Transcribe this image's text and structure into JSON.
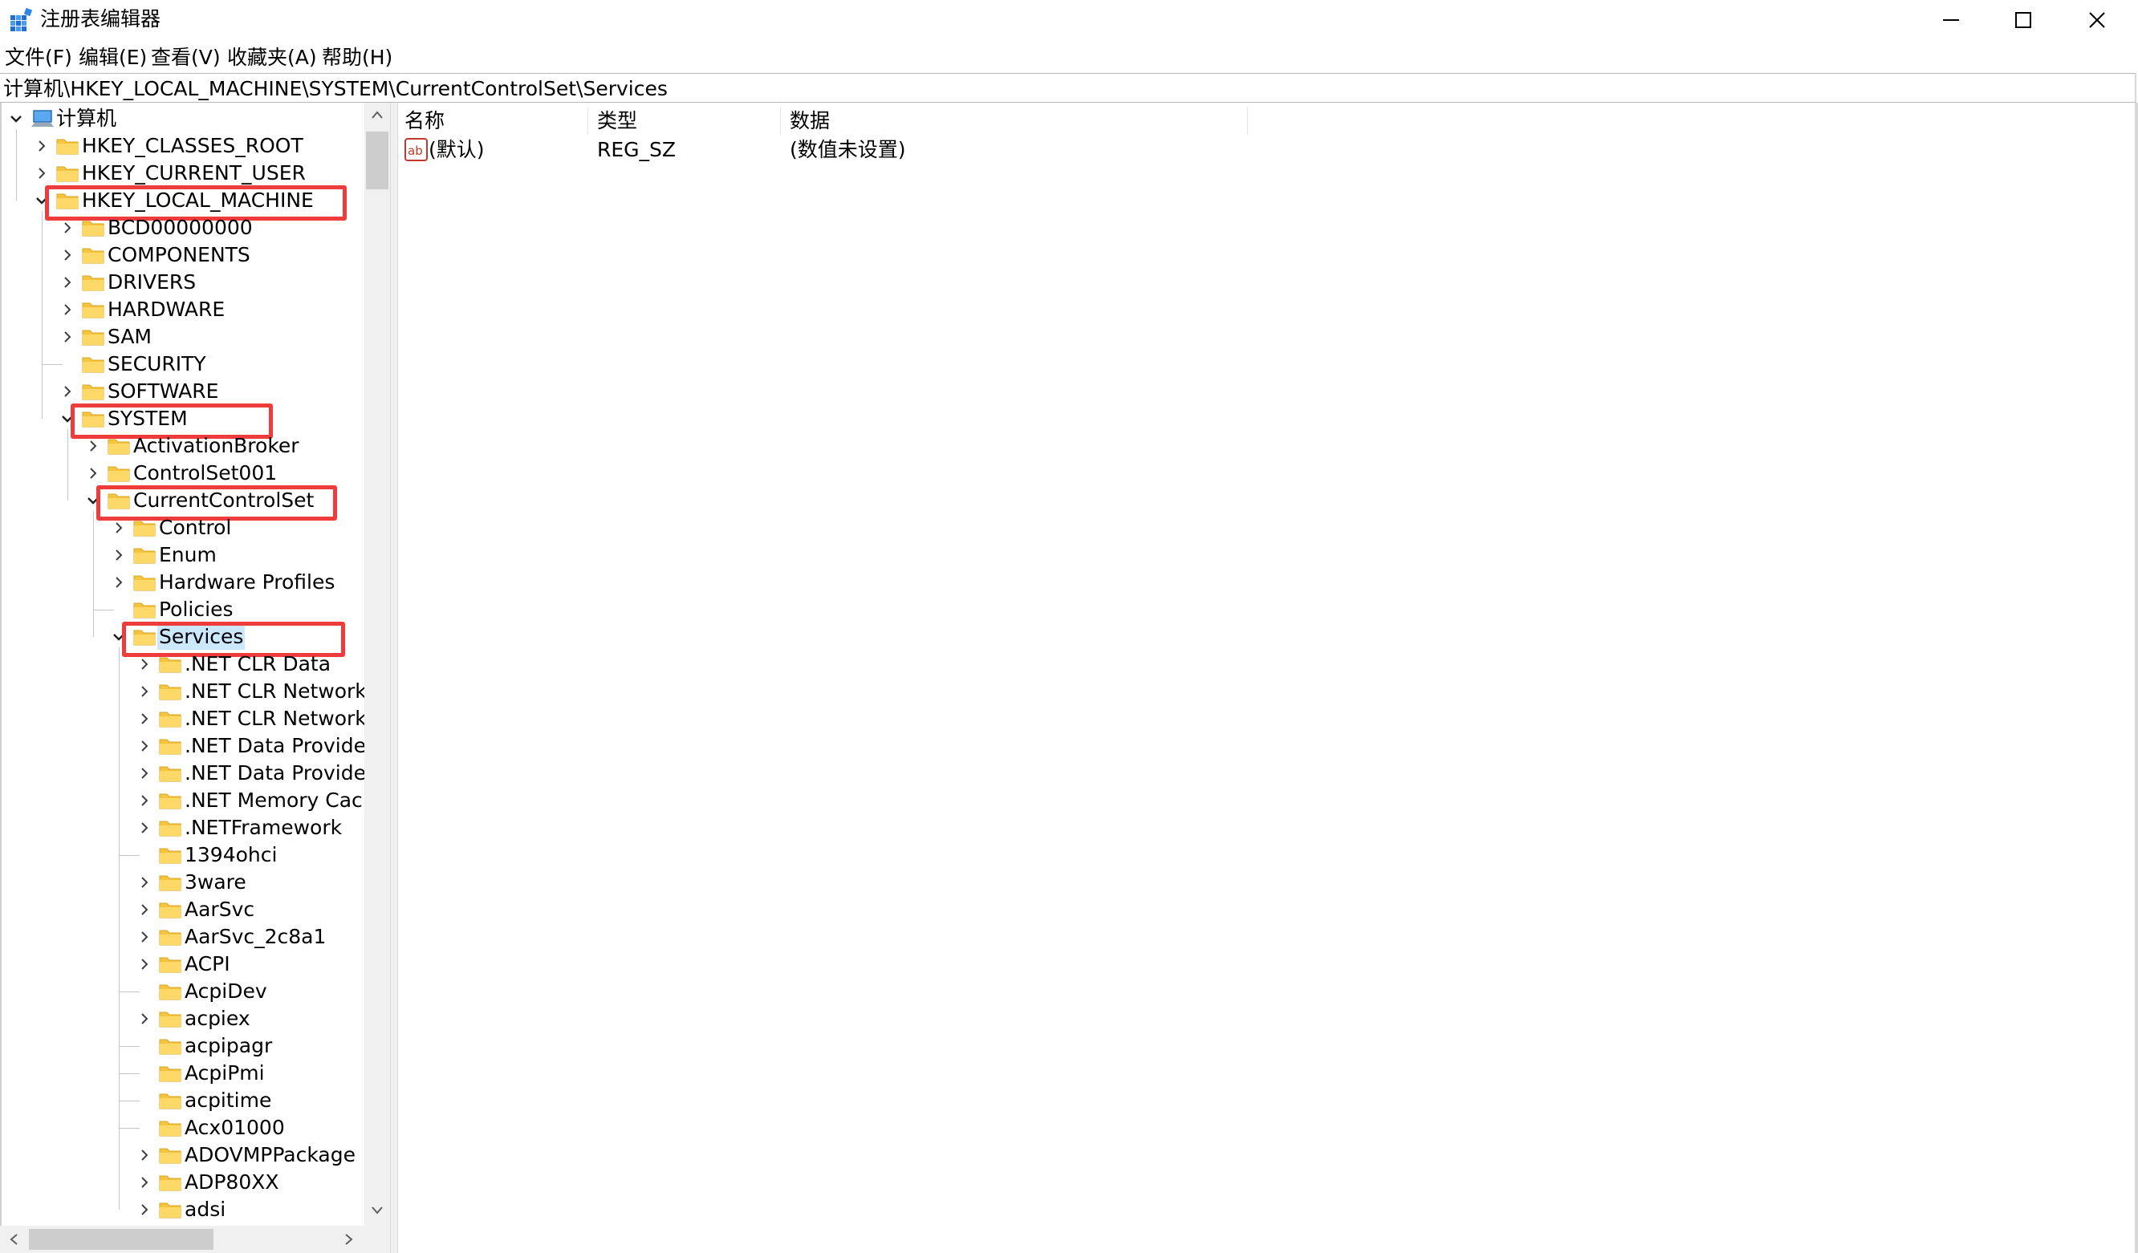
{
  "window": {
    "title": "注册表编辑器",
    "icon": "registry-editor-icon",
    "controls": [
      "minimize-icon",
      "maximize-icon",
      "close-icon"
    ]
  },
  "menu": {
    "items": [
      {
        "label": "文件(F)"
      },
      {
        "label": "编辑(E)"
      },
      {
        "label": "查看(V)"
      },
      {
        "label": "收藏夹(A)"
      },
      {
        "label": "帮助(H)"
      }
    ]
  },
  "address": {
    "path": "计算机\\HKEY_LOCAL_MACHINE\\SYSTEM\\CurrentControlSet\\Services"
  },
  "tree": {
    "root": {
      "label": "计算机",
      "icon": "computer-icon",
      "expanded": true
    },
    "nodes": [
      {
        "label": "HKEY_CLASSES_ROOT",
        "depth": 1,
        "state": "collapsed"
      },
      {
        "label": "HKEY_CURRENT_USER",
        "depth": 1,
        "state": "collapsed"
      },
      {
        "label": "HKEY_LOCAL_MACHINE",
        "depth": 1,
        "state": "expanded",
        "highlighted": true
      },
      {
        "label": "BCD00000000",
        "depth": 2,
        "state": "collapsed"
      },
      {
        "label": "COMPONENTS",
        "depth": 2,
        "state": "collapsed"
      },
      {
        "label": "DRIVERS",
        "depth": 2,
        "state": "collapsed"
      },
      {
        "label": "HARDWARE",
        "depth": 2,
        "state": "collapsed"
      },
      {
        "label": "SAM",
        "depth": 2,
        "state": "collapsed"
      },
      {
        "label": "SECURITY",
        "depth": 2,
        "state": "leaf"
      },
      {
        "label": "SOFTWARE",
        "depth": 2,
        "state": "collapsed"
      },
      {
        "label": "SYSTEM",
        "depth": 2,
        "state": "expanded",
        "highlighted": true
      },
      {
        "label": "ActivationBroker",
        "depth": 3,
        "state": "collapsed"
      },
      {
        "label": "ControlSet001",
        "depth": 3,
        "state": "collapsed"
      },
      {
        "label": "CurrentControlSet",
        "depth": 3,
        "state": "expanded",
        "highlighted": true
      },
      {
        "label": "Control",
        "depth": 4,
        "state": "collapsed"
      },
      {
        "label": "Enum",
        "depth": 4,
        "state": "collapsed"
      },
      {
        "label": "Hardware Profiles",
        "depth": 4,
        "state": "collapsed"
      },
      {
        "label": "Policies",
        "depth": 4,
        "state": "leaf"
      },
      {
        "label": "Services",
        "depth": 4,
        "state": "expanded",
        "highlighted": true,
        "selected": true
      },
      {
        "label": ".NET CLR Data",
        "depth": 5,
        "state": "collapsed"
      },
      {
        "label": ".NET CLR Networki",
        "depth": 5,
        "state": "collapsed"
      },
      {
        "label": ".NET CLR Networki",
        "depth": 5,
        "state": "collapsed"
      },
      {
        "label": ".NET Data Provider",
        "depth": 5,
        "state": "collapsed"
      },
      {
        "label": ".NET Data Provider",
        "depth": 5,
        "state": "collapsed"
      },
      {
        "label": ".NET Memory Cach",
        "depth": 5,
        "state": "collapsed"
      },
      {
        "label": ".NETFramework",
        "depth": 5,
        "state": "collapsed"
      },
      {
        "label": "1394ohci",
        "depth": 5,
        "state": "leaf"
      },
      {
        "label": "3ware",
        "depth": 5,
        "state": "collapsed"
      },
      {
        "label": "AarSvc",
        "depth": 5,
        "state": "collapsed"
      },
      {
        "label": "AarSvc_2c8a1",
        "depth": 5,
        "state": "collapsed"
      },
      {
        "label": "ACPI",
        "depth": 5,
        "state": "collapsed"
      },
      {
        "label": "AcpiDev",
        "depth": 5,
        "state": "leaf"
      },
      {
        "label": "acpiex",
        "depth": 5,
        "state": "collapsed"
      },
      {
        "label": "acpipagr",
        "depth": 5,
        "state": "leaf"
      },
      {
        "label": "AcpiPmi",
        "depth": 5,
        "state": "leaf"
      },
      {
        "label": "acpitime",
        "depth": 5,
        "state": "leaf"
      },
      {
        "label": "Acx01000",
        "depth": 5,
        "state": "leaf"
      },
      {
        "label": "ADOVMPPackage",
        "depth": 5,
        "state": "collapsed"
      },
      {
        "label": "ADP80XX",
        "depth": 5,
        "state": "collapsed"
      },
      {
        "label": "adsi",
        "depth": 5,
        "state": "collapsed"
      }
    ]
  },
  "list": {
    "columns": [
      "名称",
      "类型",
      "数据"
    ],
    "rows": [
      {
        "name": "(默认)",
        "type": "REG_SZ",
        "data": "(数值未设置)",
        "icon": "string-value-icon"
      }
    ]
  },
  "colors": {
    "highlight_box": "#ee3b3b",
    "selection": "#cce8ff",
    "folder": "#f5c542"
  }
}
